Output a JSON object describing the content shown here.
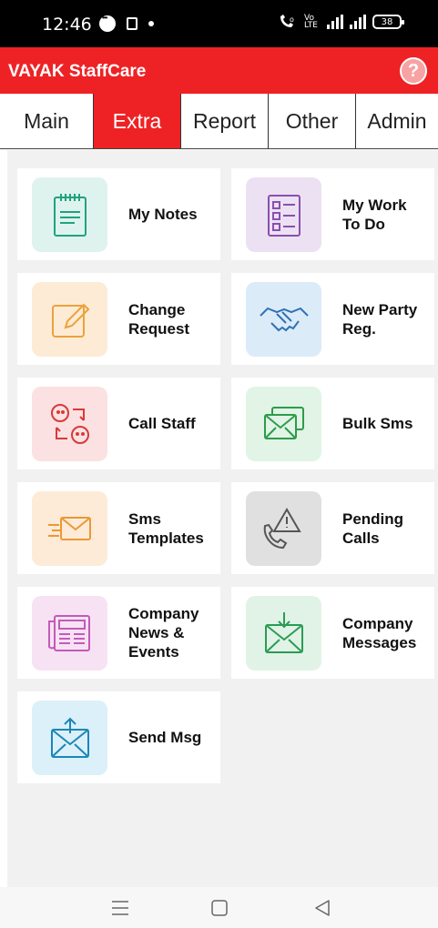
{
  "status_bar": {
    "time": "12:46",
    "network_label": "Vo LTE",
    "battery": "38"
  },
  "app_bar": {
    "title": "VAYAK StaffCare",
    "help": "?"
  },
  "tabs": [
    {
      "label": "Main",
      "active": false
    },
    {
      "label": "Extra",
      "active": true
    },
    {
      "label": "Report",
      "active": false
    },
    {
      "label": "Other",
      "active": false
    },
    {
      "label": "Admin",
      "active": false
    }
  ],
  "colors": {
    "brand_red": "#ee2225",
    "background": "#f1f1f1"
  },
  "menu_items": [
    {
      "label": "My Notes",
      "icon": "notepad-icon",
      "tile_color": "#dff3ee"
    },
    {
      "label": "My Work To Do",
      "icon": "checklist-icon",
      "tile_color": "#ece1f2"
    },
    {
      "label": "Change Request",
      "icon": "edit-icon",
      "tile_color": "#fdebd5"
    },
    {
      "label": "New Party Reg.",
      "icon": "handshake-icon",
      "tile_color": "#dcebf8"
    },
    {
      "label": "Call Staff",
      "icon": "call-staff-icon",
      "tile_color": "#fbe1e1"
    },
    {
      "label": "Bulk Sms",
      "icon": "bulk-sms-icon",
      "tile_color": "#e1f4e6"
    },
    {
      "label": "Sms Templates",
      "icon": "sms-template-icon",
      "tile_color": "#fdebd8"
    },
    {
      "label": "Pending Calls",
      "icon": "pending-call-icon",
      "tile_color": "#e0e0e0"
    },
    {
      "label": "Company News & Events",
      "icon": "news-icon",
      "tile_color": "#f7e2f4"
    },
    {
      "label": "Company Messages",
      "icon": "company-message-icon",
      "tile_color": "#e1f3e6"
    },
    {
      "label": "Send Msg",
      "icon": "send-msg-icon",
      "tile_color": "#dbf0f8"
    }
  ]
}
